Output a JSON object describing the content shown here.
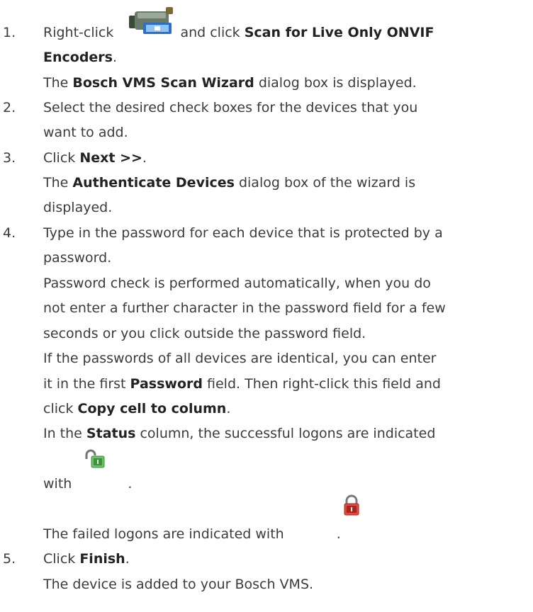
{
  "steps": [
    {
      "number": "1.",
      "line1_pre": "Right-click",
      "line1_post": "and click",
      "line1_bold": "Scan for Live Only ONVIF",
      "line2_bold": "Encoders",
      "line2_post": ".",
      "line3_pre": "The",
      "line3_bold": "Bosch VMS Scan Wizard",
      "line3_post": "dialog box is displayed.",
      "icon": "camera-icon"
    },
    {
      "number": "2.",
      "line1": "Select the desired check boxes for the devices that you",
      "line2": "want to add."
    },
    {
      "number": "3.",
      "line1_pre": "Click",
      "line1_bold": "Next >>",
      "line1_post": ".",
      "line2_pre": "The",
      "line2_bold": "Authenticate Devices",
      "line2_post": "dialog box of the wizard is",
      "line3": "displayed."
    },
    {
      "number": "4.",
      "line1": "Type in the password for each device that is protected by a",
      "line2": "password.",
      "line3": "Password check is performed automatically, when you do",
      "line4": "not enter a further character in the password field for a few",
      "line5": "seconds or you click outside the password field.",
      "line6": "If the passwords of all devices are identical, you can enter",
      "line7_pre": "it in the first",
      "line7_bold": "Password",
      "line7_post": "field. Then right-click this field and",
      "line8_pre": "click",
      "line8_bold": "Copy cell to column",
      "line8_post": ".",
      "line9_pre": "In the",
      "line9_bold": "Status",
      "line9_post": "column, the successful logons are indicated",
      "line10_pre": "with",
      "line10_post": ".",
      "line11_pre": "The failed logons are indicated with",
      "line11_post": ".",
      "icon_success": "unlocked-padlock-icon",
      "icon_failed": "locked-padlock-icon"
    },
    {
      "number": "5.",
      "line1_pre": "Click",
      "line1_bold": "Finish",
      "line1_post": ".",
      "line2": "The device is added to your Bosch VMS."
    }
  ],
  "colors": {
    "text": "#3b3b3b",
    "lock_green": "#5cb85c",
    "lock_red": "#d9342b"
  }
}
